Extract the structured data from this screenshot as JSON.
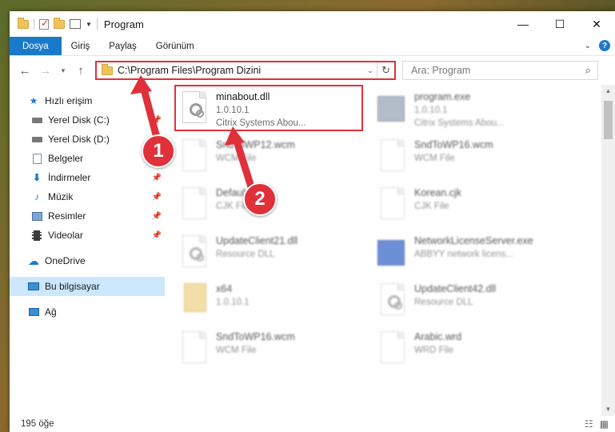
{
  "window": {
    "title": "Program"
  },
  "window_controls": {
    "minimize": "—",
    "maximize": "☐",
    "close": "✕"
  },
  "ribbon": {
    "tabs": [
      "Dosya",
      "Giriş",
      "Paylaş",
      "Görünüm"
    ]
  },
  "nav": {
    "back": "←",
    "forward": "→",
    "recent": "▾",
    "up": "↑"
  },
  "address": {
    "path": "C:\\Program Files\\Program Dizini"
  },
  "search": {
    "placeholder": "Ara: Program"
  },
  "sidebar": {
    "items": [
      {
        "label": "Hızlı erişim",
        "icon": "star-icon",
        "pinned": false
      },
      {
        "label": "Yerel Disk (C:)",
        "icon": "drive-icon",
        "pinned": true
      },
      {
        "label": "Yerel Disk (D:)",
        "icon": "drive-icon",
        "pinned": true
      },
      {
        "label": "Belgeler",
        "icon": "documents-icon",
        "pinned": true
      },
      {
        "label": "İndirmeler",
        "icon": "download-icon",
        "pinned": true
      },
      {
        "label": "Müzik",
        "icon": "music-icon",
        "pinned": true
      },
      {
        "label": "Resimler",
        "icon": "pictures-icon",
        "pinned": true
      },
      {
        "label": "Videolar",
        "icon": "video-icon",
        "pinned": true
      },
      {
        "label": "OneDrive",
        "icon": "cloud-icon",
        "pinned": false
      },
      {
        "label": "Bu bilgisayar",
        "icon": "computer-icon",
        "pinned": false
      },
      {
        "label": "Ağ",
        "icon": "network-icon",
        "pinned": false
      }
    ]
  },
  "files": [
    {
      "name": "minabout.dll",
      "line2": "1.0.10.1",
      "line3": "Citrix Systems Abou...",
      "kind": "dll"
    },
    {
      "name": "program.exe",
      "line2": "1.0.10.1",
      "line3": "Citrix Systems Abou...",
      "kind": "app"
    },
    {
      "name": "SndToWP12.wcm",
      "line2": "WCM File",
      "line3": "",
      "kind": "doc"
    },
    {
      "name": "SndToWP16.wcm",
      "line2": "WCM File",
      "line3": "",
      "kind": "doc"
    },
    {
      "name": "Default.cjk",
      "line2": "CJK File",
      "line3": "",
      "kind": "doc"
    },
    {
      "name": "Korean.cjk",
      "line2": "CJK File",
      "line3": "",
      "kind": "doc"
    },
    {
      "name": "UpdateClient21.dll",
      "line2": "Resource DLL",
      "line3": "",
      "kind": "dll"
    },
    {
      "name": "NetworkLicenseServer.exe",
      "line2": "ABBYY network licens...",
      "line3": "",
      "kind": "app"
    },
    {
      "name": "x64",
      "line2": "1.0.10.1",
      "line3": "",
      "kind": "folder"
    },
    {
      "name": "UpdateClient42.dll",
      "line2": "Resource DLL",
      "line3": "",
      "kind": "dll"
    },
    {
      "name": "SndToWP16.wcm",
      "line2": "WCM File",
      "line3": "",
      "kind": "doc"
    },
    {
      "name": "Arabic.wrd",
      "line2": "WRD File",
      "line3": "",
      "kind": "doc"
    }
  ],
  "status": {
    "count": "195 öğe"
  },
  "callouts": [
    "1",
    "2"
  ],
  "colors": {
    "accent": "#1979ca",
    "highlight": "#e0303a",
    "selected_bg": "#cce8ff"
  }
}
